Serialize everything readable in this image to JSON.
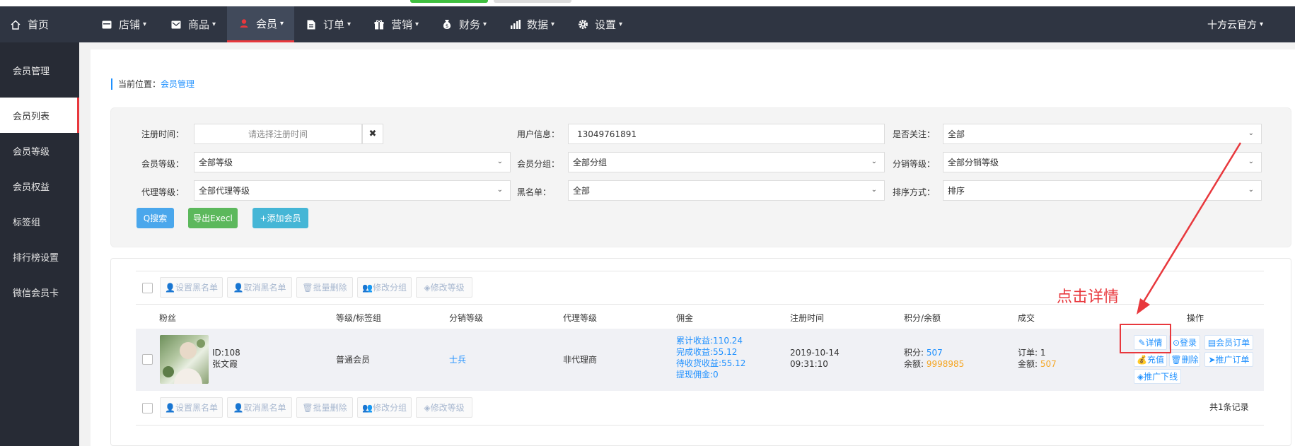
{
  "nav": {
    "home": "首页",
    "items": [
      {
        "label": "店铺",
        "icon": "shop-icon"
      },
      {
        "label": "商品",
        "icon": "product-icon"
      },
      {
        "label": "会员",
        "icon": "member-icon"
      },
      {
        "label": "订单",
        "icon": "order-icon"
      },
      {
        "label": "营销",
        "icon": "gift-icon"
      },
      {
        "label": "财务",
        "icon": "moneybag-icon"
      },
      {
        "label": "数据",
        "icon": "chart-icon"
      },
      {
        "label": "设置",
        "icon": "gear-icon"
      }
    ],
    "active": "会员",
    "user": "十方云官方"
  },
  "sidebar": {
    "items": [
      "会员管理",
      "会员列表",
      "会员等级",
      "会员权益",
      "标签组",
      "排行榜设置",
      "微信会员卡"
    ],
    "active": "会员列表"
  },
  "breadcrumb": {
    "prefix": "当前位置：",
    "current": "会员管理"
  },
  "filters": {
    "reg_time_label": "注册时间：",
    "reg_time_placeholder": "请选择注册时间",
    "user_info_label": "用户信息：",
    "user_info_value": "13049761891",
    "follow_label": "是否关注：",
    "follow_value": "全部",
    "level_label": "会员等级：",
    "level_value": "全部等级",
    "group_label": "会员分组：",
    "group_value": "全部分组",
    "dist_label": "分销等级：",
    "dist_value": "全部分销等级",
    "agent_label": "代理等级：",
    "agent_value": "全部代理等级",
    "blacklist_label": "黑名单：",
    "blacklist_value": "全部",
    "sort_label": "排序方式：",
    "sort_value": "排序"
  },
  "buttons": {
    "search": "Q搜索",
    "export": "导出Execl",
    "add": "+添加会员"
  },
  "toolbar": [
    "设置黑名单",
    "取消黑名单",
    "批量删除",
    "修改分组",
    "修改等级"
  ],
  "table": {
    "headers": [
      "粉丝",
      "等级/标签组",
      "分销等级",
      "代理等级",
      "佣金",
      "注册时间",
      "积分/余额",
      "成交",
      "操作"
    ],
    "row": {
      "id": "ID:108",
      "name": "张文霞",
      "level": "普通会员",
      "dist_level": "士兵",
      "agent_level": "非代理商",
      "commission": [
        "累计收益:110.24",
        "完成收益:55.12",
        "待收货收益:55.12",
        "提现佣金:0"
      ],
      "reg_date": "2019-10-14",
      "reg_time": "09:31:10",
      "points_label": "积分: ",
      "points": "507",
      "balance_label": "余额: ",
      "balance": "9998985",
      "orders_label": "订单: ",
      "orders": "1",
      "amount_label": "金额: ",
      "amount": "507",
      "ops": [
        "详情",
        "登录",
        "会员订单",
        "充值",
        "删除",
        "推广订单",
        "推广下线"
      ]
    },
    "total": "共1条记录"
  },
  "annotation": {
    "text": "点击详情",
    "color": "#e8383d"
  }
}
